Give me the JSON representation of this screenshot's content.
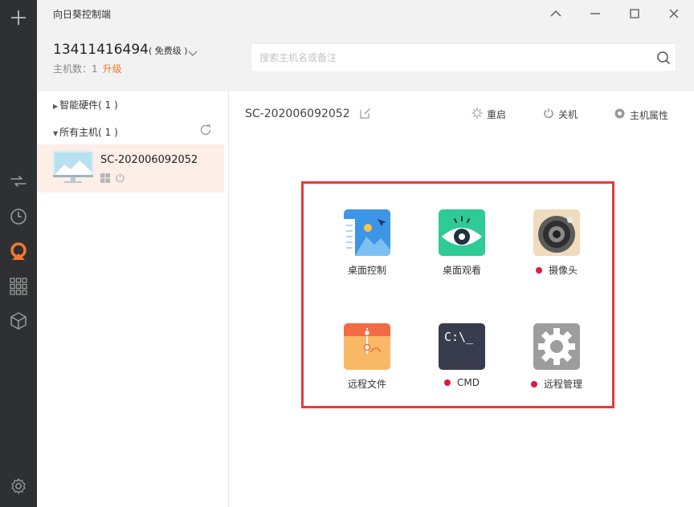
{
  "window": {
    "title": "向日葵控制端"
  },
  "account": {
    "id": "13411416494",
    "level": "( 免费级 )",
    "host_count_label": "主机数：1",
    "upgrade_label": "升级"
  },
  "search": {
    "placeholder": "搜索主机名或备注"
  },
  "groups": [
    {
      "label": "智能硬件( 1 )",
      "expanded": false
    },
    {
      "label": "所有主机( 1 )",
      "expanded": true
    }
  ],
  "host": {
    "name": "SC-202006092052"
  },
  "main": {
    "host_name": "SC-202006092052",
    "actions": [
      {
        "label": "重启",
        "icon": "restart-icon"
      },
      {
        "label": "关机",
        "icon": "power-icon"
      },
      {
        "label": "主机属性",
        "icon": "settings-icon"
      }
    ],
    "features": [
      {
        "label": "桌面控制",
        "icon": "desktop-control-icon",
        "status_dot": false
      },
      {
        "label": "桌面观看",
        "icon": "desktop-view-icon",
        "status_dot": false
      },
      {
        "label": "摄像头",
        "icon": "camera-icon",
        "status_dot": true
      },
      {
        "label": "远程文件",
        "icon": "remote-file-icon",
        "status_dot": false
      },
      {
        "label": "CMD",
        "icon": "cmd-icon",
        "status_dot": true,
        "glyph": "C:\\_"
      },
      {
        "label": "远程管理",
        "icon": "remote-manage-icon",
        "status_dot": true
      }
    ]
  },
  "colors": {
    "rail": "#2f3033",
    "accent": "#f3792a",
    "highlight": "#e33b3b",
    "selected_row": "#fdeee7",
    "offline_dot": "#e4173f"
  }
}
